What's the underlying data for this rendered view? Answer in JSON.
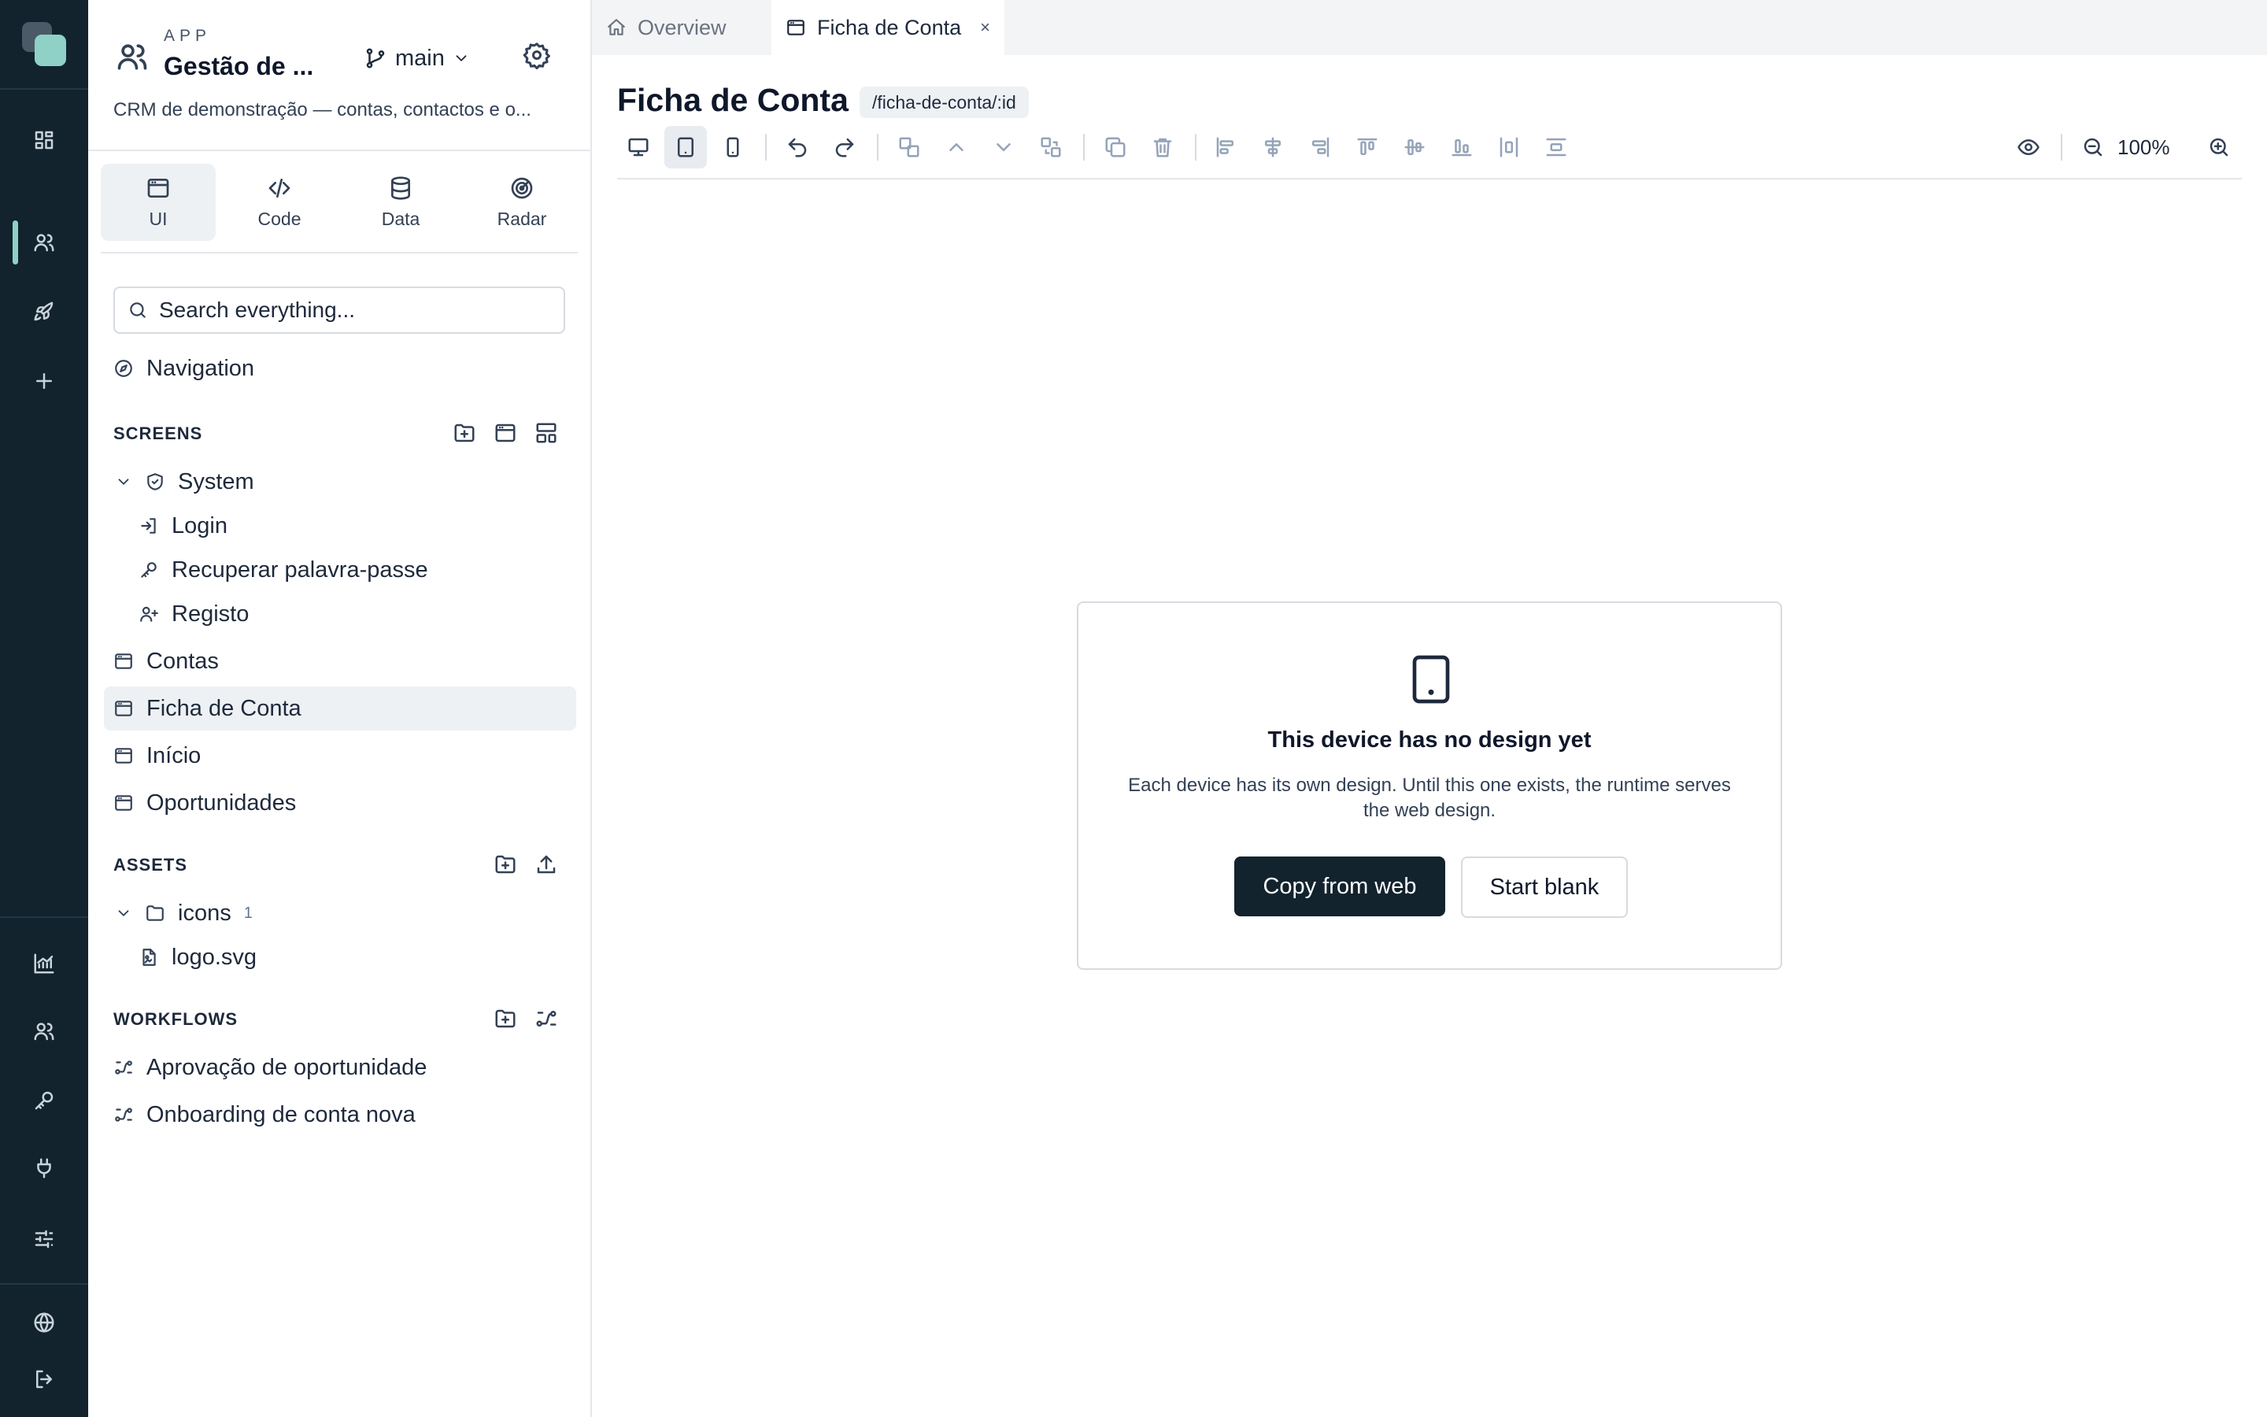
{
  "app": {
    "kicker": "APP",
    "name": "Gestão de ...",
    "branch": "main",
    "description": "CRM de demonstração — contas, contactos e o..."
  },
  "mode_tabs": [
    {
      "label": "UI",
      "icon": "window-icon",
      "active": true
    },
    {
      "label": "Code",
      "icon": "code-icon"
    },
    {
      "label": "Data",
      "icon": "database-icon"
    },
    {
      "label": "Radar",
      "icon": "radar-icon"
    }
  ],
  "search": {
    "placeholder": "Search everything..."
  },
  "navigation_label": "Navigation",
  "screens": {
    "title": "SCREENS",
    "system_group": "System",
    "system_items": [
      "Login",
      "Recuperar palavra-passe",
      "Registo"
    ],
    "items": [
      "Contas",
      "Ficha de Conta",
      "Início",
      "Oportunidades"
    ],
    "selected": "Ficha de Conta"
  },
  "assets": {
    "title": "ASSETS",
    "folder": "icons",
    "folder_count": "1",
    "file": "logo.svg"
  },
  "workflows": {
    "title": "WORKFLOWS",
    "items": [
      "Aprovação de oportunidade",
      "Onboarding de conta nova"
    ]
  },
  "tabs": [
    {
      "label": "Overview",
      "icon": "home-icon"
    },
    {
      "label": "Ficha de Conta",
      "icon": "window-icon",
      "active": true,
      "close": "×"
    }
  ],
  "page": {
    "title": "Ficha de Conta",
    "route": "/ficha-de-conta/:id"
  },
  "toolbar": {
    "active_device": "tablet",
    "zoom": "100%"
  },
  "empty_state": {
    "title": "This device has no design yet",
    "description": "Each device has its own design. Until this one exists, the runtime serves the web design.",
    "primary_button": "Copy from web",
    "secondary_button": "Start blank"
  },
  "colors": {
    "rail_bg": "#12232e",
    "accent": "#8fd1c6",
    "primary_button": "#12232e"
  }
}
